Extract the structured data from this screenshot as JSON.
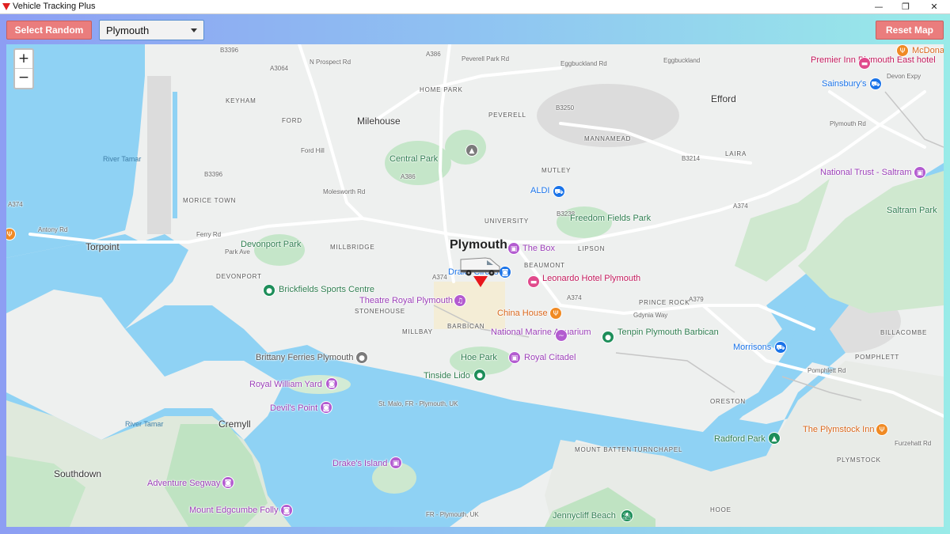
{
  "window": {
    "title": "Vehicle Tracking Plus",
    "minimize": "—",
    "maximize": "❐",
    "close": "✕"
  },
  "toolbar": {
    "select_random_label": "Select Random",
    "city_value": "Plymouth",
    "reset_map_label": "Reset Map",
    "button_color": "#ea7d7d"
  },
  "map": {
    "zoom_in": "+",
    "zoom_out": "−",
    "city_label": "Plymouth",
    "areas": {
      "milehouse": "Milehouse",
      "efford": "Efford",
      "torpoint": "Torpoint",
      "cremyll": "Cremyll",
      "southdown": "Southdown"
    },
    "districts": {
      "home_park": "HOME PARK",
      "keyham": "KEYHAM",
      "ford": "FORD",
      "peverell": "PEVERELL",
      "mannamead": "MANNAMEAD",
      "laira": "LAIRA",
      "mutley": "MUTLEY",
      "university": "UNIVERSITY",
      "morice_town": "MORICE TOWN",
      "millbridge": "MILLBRIDGE",
      "lipson": "LIPSON",
      "beaumont": "BEAUMONT",
      "devonport": "DEVONPORT",
      "stonehouse": "STONEHOUSE",
      "barbican": "BARBICAN",
      "millbay": "MILLBAY",
      "prince_rock": "PRINCE ROCK",
      "billacombe": "BILLACOMBE",
      "pomphlett": "POMPHLETT",
      "oreston": "ORESTON",
      "mount_batten": "MOUNT BATTEN",
      "turnchapel": "TURNCHAPEL",
      "plymstock": "PLYMSTOCK",
      "hooe": "HOOE"
    },
    "roads": {
      "a386_n": "A386",
      "a3064": "A3064",
      "b3396_n": "B3396",
      "prospect": "N Prospect Rd",
      "peverell_rd": "Peverell Park Rd",
      "eggbuckland": "Eggbuckland Rd",
      "eggbuckland_2": "Eggbuckland",
      "b3250": "B3250",
      "ford_hill": "Ford Hill",
      "b3396_s": "B3396",
      "a374_w": "A374",
      "antony": "Antony Rd",
      "ferry": "Ferry Rd",
      "park_ave": "Park Ave",
      "molesworth": "Molesworth Rd",
      "a386_c": "A386",
      "b3238": "B3238",
      "b3214": "B3214",
      "plymouth_rd": "Plymouth Rd",
      "devon_expy": "Devon Expy",
      "a374_e": "A374",
      "a374_c": "A374",
      "a374_n": "A374",
      "a379": "A379",
      "gdynia": "Gdynia Way",
      "pomphlett_rd": "Pomphlett Rd",
      "furzehatt": "Furzehatt Rd",
      "st_malo": "St. Malo, FR - Plymouth, UK",
      "pl_uk": "FR - Plymouth, UK"
    },
    "water": {
      "tamar_n": "River Tamar",
      "tamar_s": "River Tamar"
    },
    "pois": {
      "central_park": "Central Park",
      "devonport_park": "Devonport Park",
      "freedom_fields": "Freedom Fields Park",
      "aldi": "ALDI",
      "the_box": "The Box",
      "drake_circus": "Drake Circus",
      "brickfields": "Brickfields Sports Centre",
      "theatre_royal": "Theatre Royal Plymouth",
      "leonardo": "Leonardo Hotel Plymouth",
      "china_house": "China House",
      "aquarium": "National Marine Aquarium",
      "tenpin": "Tenpin Plymouth Barbican",
      "brittany": "Brittany Ferries Plymouth",
      "hoe_park": "Hoe Park",
      "royal_citadel": "Royal Citadel",
      "tinside": "Tinside Lido",
      "royal_william": "Royal William Yard",
      "devils_point": "Devil's Point",
      "drakes_island": "Drake's Island",
      "adventure_segway": "Adventure Segway",
      "mount_edgcumbe": "Mount Edgcumbe Folly",
      "premier_inn": "Premier Inn Plymouth East hotel",
      "mcdonalds": "McDona",
      "sainsburys": "Sainsbury's",
      "saltram": "National Trust - Saltram",
      "saltram_park": "Saltram Park",
      "morrisons": "Morrisons",
      "radford_park": "Radford Park",
      "plymstock_inn": "The Plymstock Inn",
      "jennycliff": "Jennycliff Beach"
    }
  }
}
